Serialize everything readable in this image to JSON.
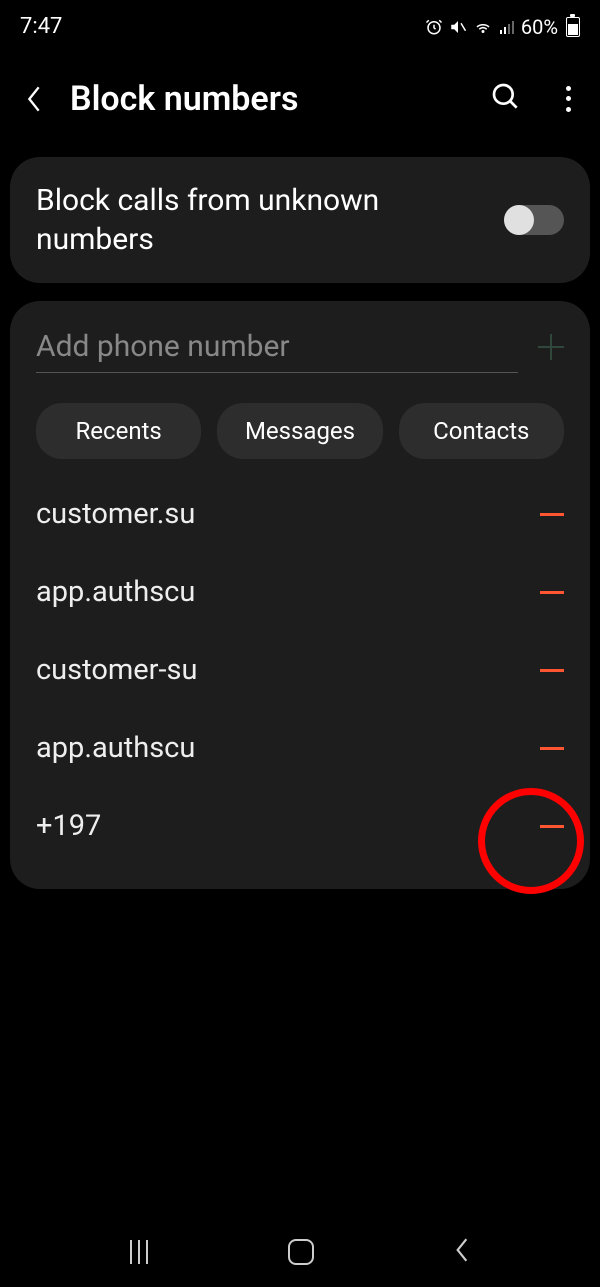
{
  "statusBar": {
    "time": "7:47",
    "battery": "60%"
  },
  "header": {
    "title": "Block numbers"
  },
  "toggleCard": {
    "label": "Block calls from unknown numbers"
  },
  "input": {
    "placeholder": "Add phone number"
  },
  "chips": {
    "recents": "Recents",
    "messages": "Messages",
    "contacts": "Contacts"
  },
  "blocked": [
    "customer.su",
    "app.authscu",
    "customer-su",
    "app.authscu",
    "+197"
  ]
}
